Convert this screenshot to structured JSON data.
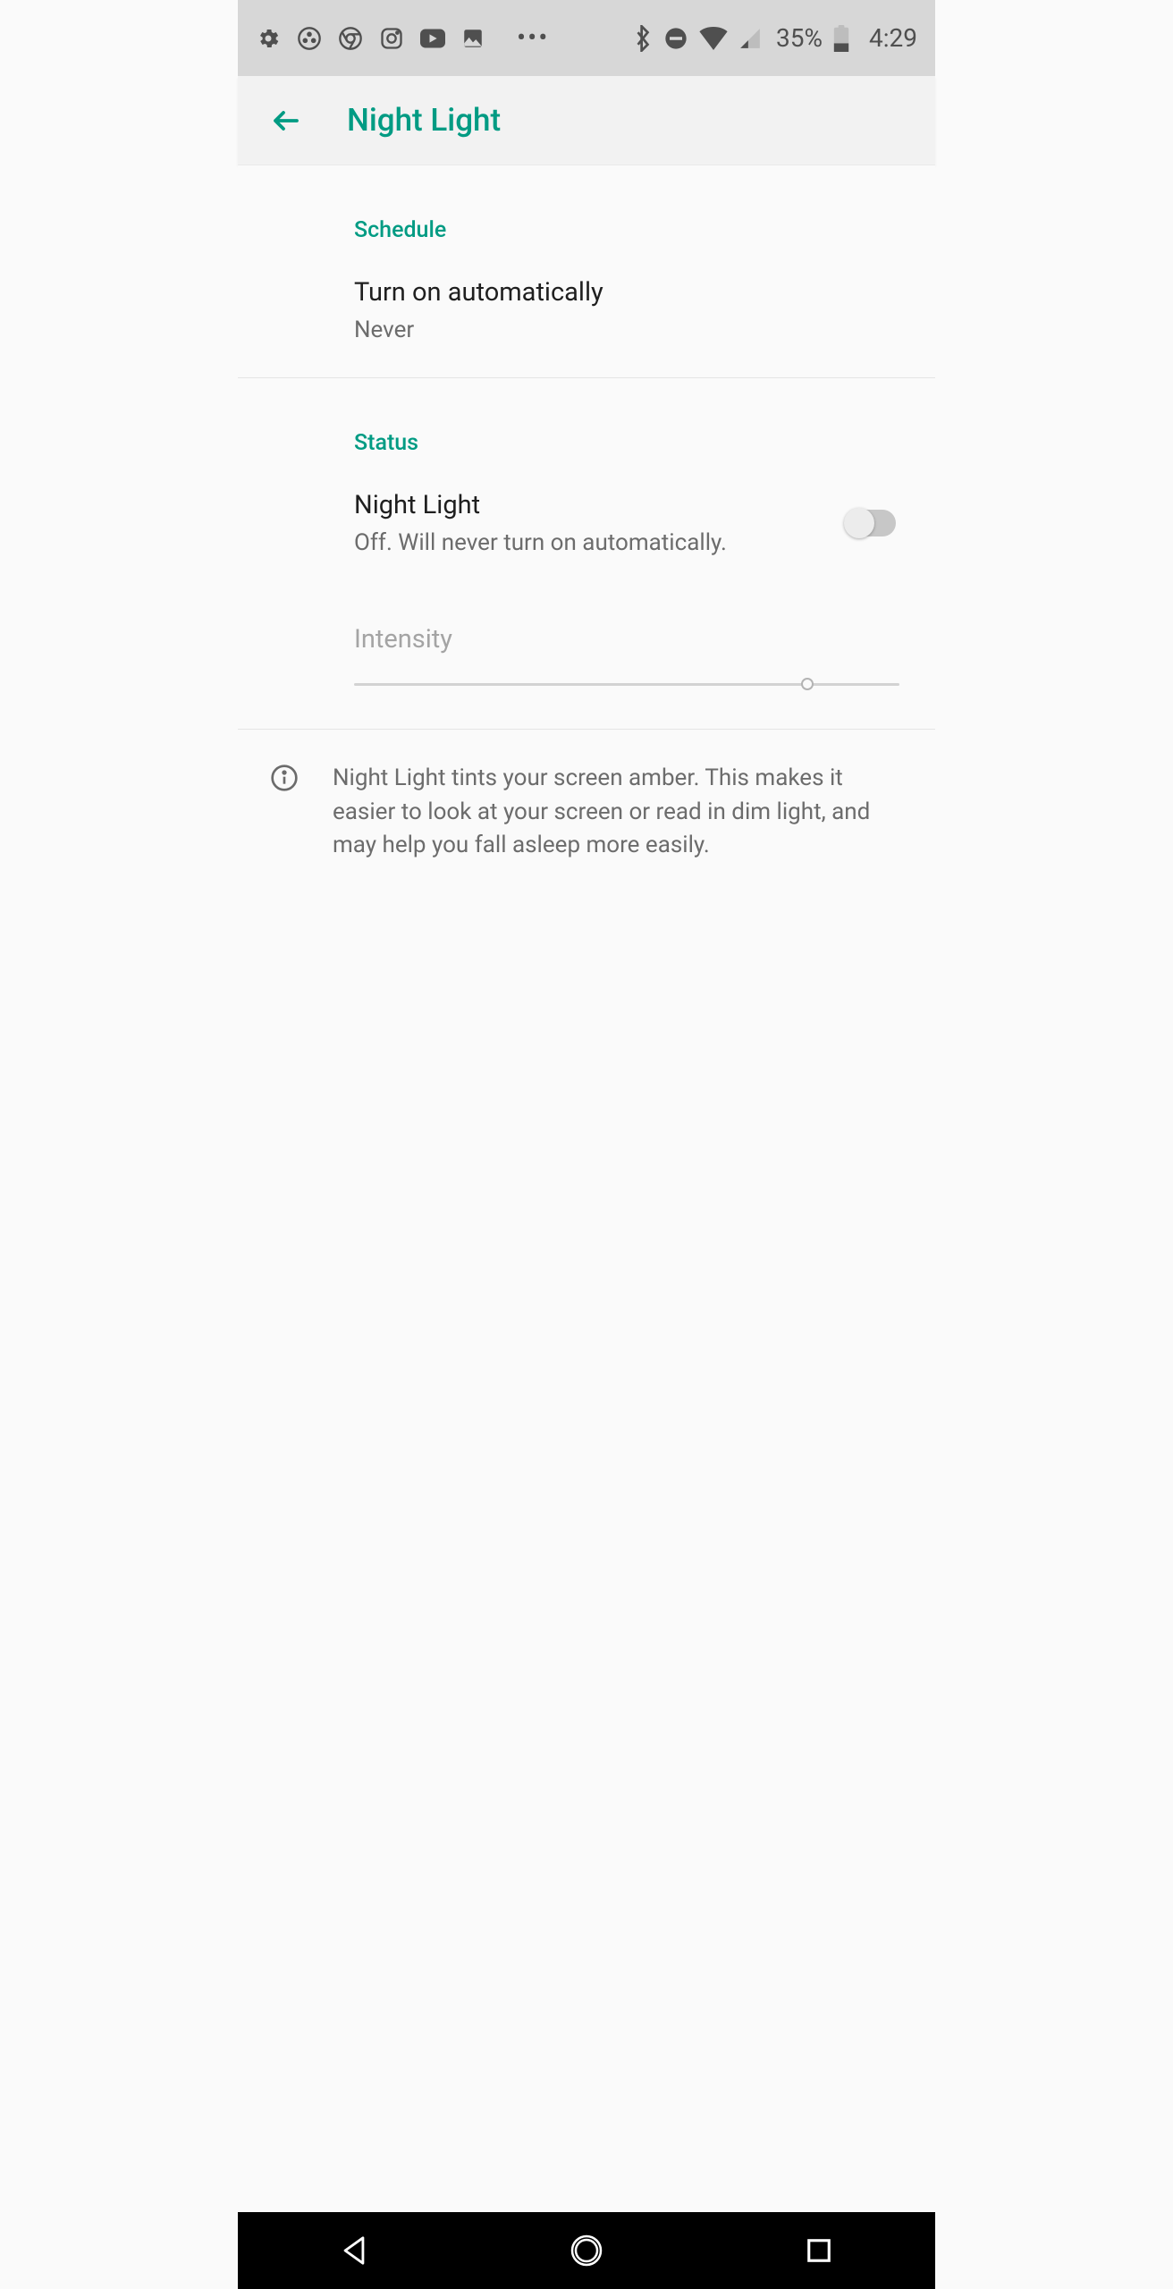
{
  "colors": {
    "accent": "#019b83",
    "text_primary": "#1f1f1f",
    "text_secondary": "#6c6c6c",
    "disabled": "#a4a4a4"
  },
  "status_bar": {
    "left_icons": [
      "settings-icon",
      "group-icon",
      "chrome-icon",
      "instagram-icon",
      "youtube-icon",
      "gallery-icon",
      "more-icon"
    ],
    "right_icons": [
      "bluetooth-icon",
      "do-not-disturb-icon",
      "wifi-icon",
      "cell-signal-icon",
      "battery-icon"
    ],
    "battery_percent": "35%",
    "time": "4:29"
  },
  "app_bar": {
    "title": "Night Light"
  },
  "schedule": {
    "header": "Schedule",
    "turn_on": {
      "title": "Turn on automatically",
      "summary": "Never"
    }
  },
  "status": {
    "header": "Status",
    "night_light": {
      "title": "Night Light",
      "summary": "Off. Will never turn on automatically.",
      "enabled": false
    },
    "intensity": {
      "title": "Intensity",
      "value_percent": 82,
      "disabled": true
    }
  },
  "info_text": "Night Light tints your screen amber. This makes it easier to look at your screen or read in dim light, and may help you fall asleep more easily."
}
